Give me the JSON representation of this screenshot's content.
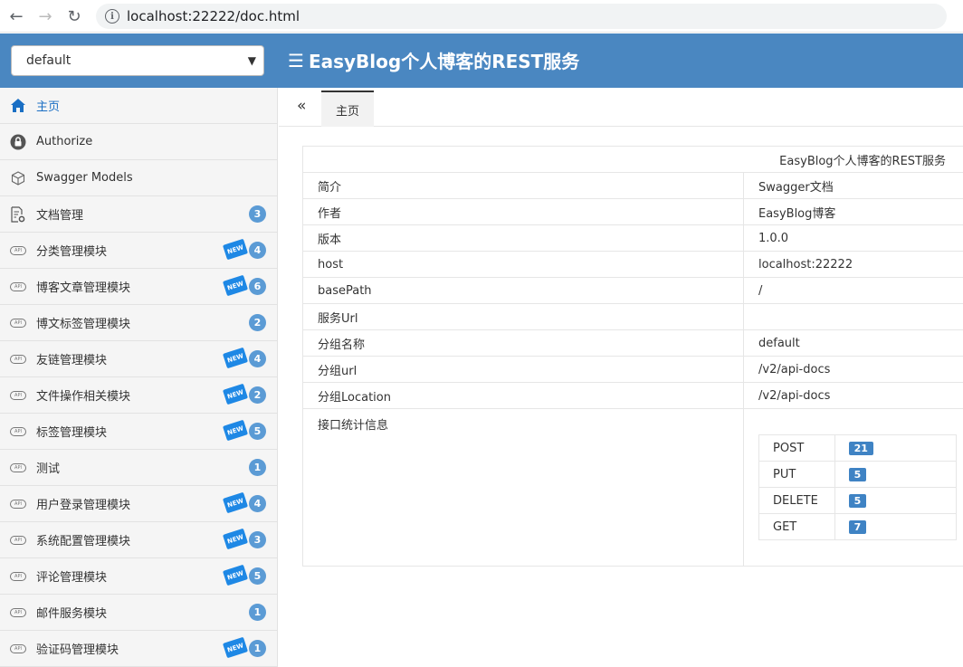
{
  "browser": {
    "url": "localhost:22222/doc.html"
  },
  "header": {
    "group_select": "default",
    "title": "EasyBlog个人博客的REST服务"
  },
  "sidebar": {
    "items": [
      {
        "label": "主页",
        "icon": "home-icon",
        "active": true
      },
      {
        "label": "Authorize",
        "icon": "lock-icon"
      },
      {
        "label": "Swagger Models",
        "icon": "cube-icon"
      },
      {
        "label": "文档管理",
        "icon": "document-settings-icon",
        "count": "3"
      },
      {
        "label": "分类管理模块",
        "icon": "api-cloud-icon",
        "count": "4",
        "new": "NEW"
      },
      {
        "label": "博客文章管理模块",
        "icon": "api-cloud-icon",
        "count": "6",
        "new": "NEW"
      },
      {
        "label": "博文标签管理模块",
        "icon": "api-cloud-icon",
        "count": "2"
      },
      {
        "label": "友链管理模块",
        "icon": "api-cloud-icon",
        "count": "4",
        "new": "NEW"
      },
      {
        "label": "文件操作相关模块",
        "icon": "api-cloud-icon",
        "count": "2",
        "new": "NEW"
      },
      {
        "label": "标签管理模块",
        "icon": "api-cloud-icon",
        "count": "5",
        "new": "NEW"
      },
      {
        "label": "测试",
        "icon": "api-cloud-icon",
        "count": "1"
      },
      {
        "label": "用户登录管理模块",
        "icon": "api-cloud-icon",
        "count": "4",
        "new": "NEW"
      },
      {
        "label": "系统配置管理模块",
        "icon": "api-cloud-icon",
        "count": "3",
        "new": "NEW"
      },
      {
        "label": "评论管理模块",
        "icon": "api-cloud-icon",
        "count": "5",
        "new": "NEW"
      },
      {
        "label": "邮件服务模块",
        "icon": "api-cloud-icon",
        "count": "1"
      },
      {
        "label": "验证码管理模块",
        "icon": "api-cloud-icon",
        "count": "1",
        "new": "NEW"
      }
    ]
  },
  "tabs": {
    "home": "主页"
  },
  "info": {
    "header": "EasyBlog个人博客的REST服务",
    "rows": [
      {
        "key": "简介",
        "value": "Swagger文档"
      },
      {
        "key": "作者",
        "value": "EasyBlog博客"
      },
      {
        "key": "版本",
        "value": "1.0.0"
      },
      {
        "key": "host",
        "value": "localhost:22222"
      },
      {
        "key": "basePath",
        "value": "/"
      },
      {
        "key": "服务Url",
        "value": ""
      },
      {
        "key": "分组名称",
        "value": "default"
      },
      {
        "key": "分组url",
        "value": "/v2/api-docs"
      },
      {
        "key": "分组Location",
        "value": "/v2/api-docs"
      }
    ],
    "stats_label": "接口统计信息",
    "stats": [
      {
        "method": "POST",
        "count": "21"
      },
      {
        "method": "PUT",
        "count": "5"
      },
      {
        "method": "DELETE",
        "count": "5"
      },
      {
        "method": "GET",
        "count": "7"
      }
    ]
  }
}
